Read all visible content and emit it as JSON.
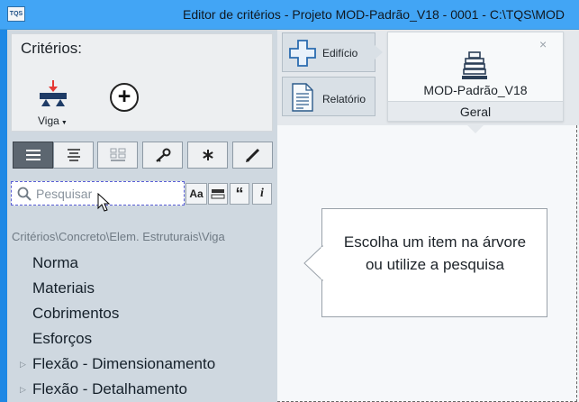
{
  "window": {
    "title": "Editor de critérios - Projeto MOD-Padrão_V18 - 0001 - C:\\TQS\\MOD",
    "app_icon_label": "TQS"
  },
  "criteria": {
    "heading": "Critérios:",
    "element_label": "Viga"
  },
  "search": {
    "placeholder": "Pesquisar",
    "value": "",
    "buttons": [
      "Aa",
      "",
      "“",
      "i"
    ]
  },
  "breadcrumb": "Critérios\\Concreto\\Elem. Estruturais\\Viga",
  "tree": {
    "items": [
      {
        "label": "Norma",
        "expandable": false
      },
      {
        "label": "Materiais",
        "expandable": false
      },
      {
        "label": "Cobrimentos",
        "expandable": false
      },
      {
        "label": "Esforços",
        "expandable": false
      },
      {
        "label": "Flexão - Dimensionamento",
        "expandable": true
      },
      {
        "label": "Flexão - Detalhamento",
        "expandable": true
      }
    ]
  },
  "nav": {
    "edificio": "Edifício",
    "relatorio": "Relatório"
  },
  "card": {
    "title": "MOD-Padrão_V18",
    "subtitle": "Geral",
    "close": "×"
  },
  "hint": {
    "text": "Escolha um item na árvore ou utilize a pesquisa"
  },
  "colors": {
    "accent": "#42a5f5",
    "panel": "#cfd8e0",
    "selected_view": "#5c6670",
    "load_arrow": "#e53935"
  }
}
